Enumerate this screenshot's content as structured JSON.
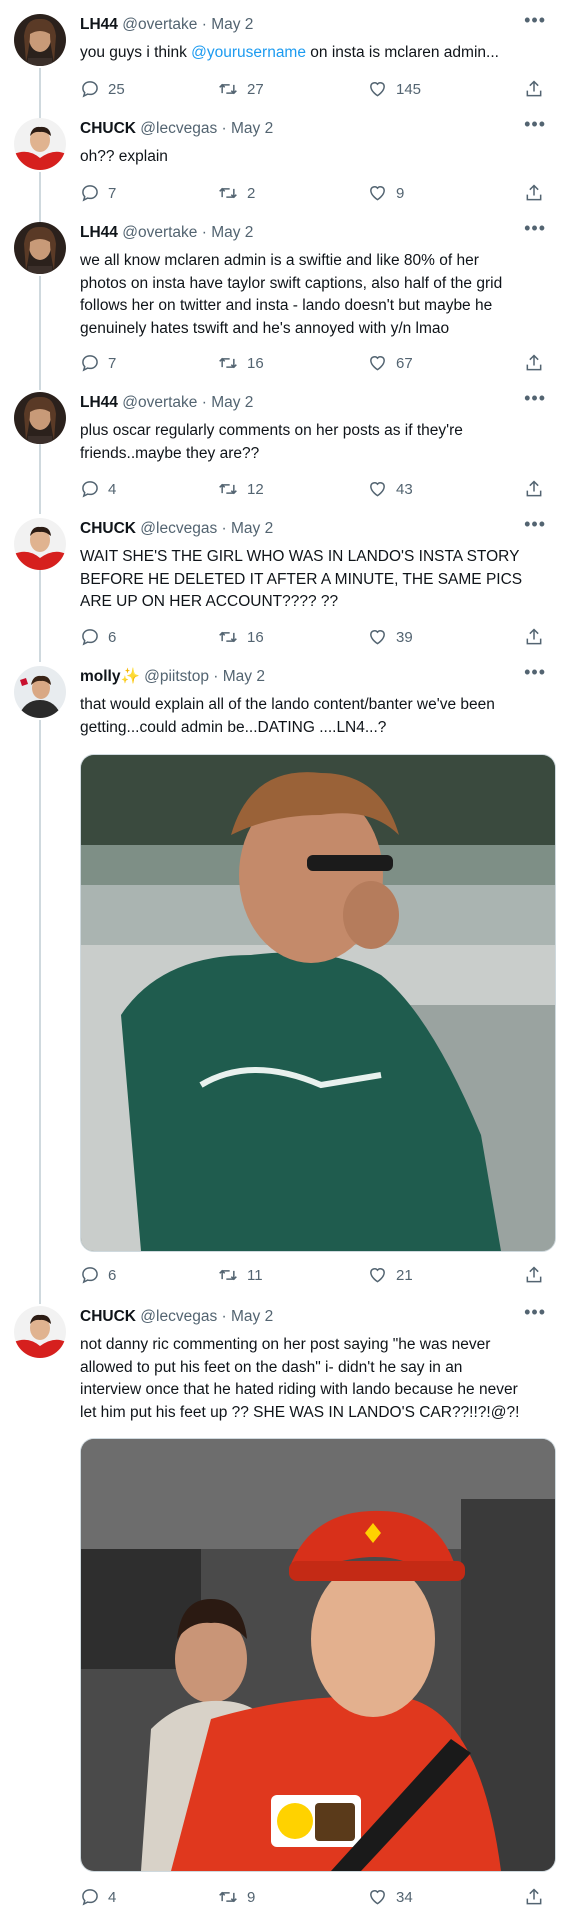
{
  "tweets": [
    {
      "name": "LH44",
      "handle": "@overtake",
      "sep": "·",
      "date": "May 2",
      "text_pre": "you guys i think ",
      "mention": "@yourusername",
      "text_post": " on insta is mclaren admin...",
      "replies": "25",
      "retweets": "27",
      "likes": "145"
    },
    {
      "name": "CHUCK",
      "handle": "@lecvegas",
      "sep": "·",
      "date": "May 2",
      "text": "oh?? explain",
      "replies": "7",
      "retweets": "2",
      "likes": "9"
    },
    {
      "name": "LH44",
      "handle": "@overtake",
      "sep": "·",
      "date": "May 2",
      "lines": [
        "we all know mclaren admin is a swiftie and like 80% of her",
        "photos on insta have taylor swift captions, also half of the grid",
        "follows her on twitter and insta - lando doesn't but maybe he",
        "genuinely hates tswift and he's annoyed with y/n lmao"
      ],
      "replies": "7",
      "retweets": "16",
      "likes": "67"
    },
    {
      "name": "LH44",
      "handle": "@overtake",
      "sep": "·",
      "date": "May 2",
      "lines": [
        "plus oscar regularly comments on her posts as if they're",
        "friends..maybe they are??"
      ],
      "replies": "4",
      "retweets": "12",
      "likes": "43"
    },
    {
      "name": "CHUCK",
      "handle": "@lecvegas",
      "sep": "·",
      "date": "May 2",
      "lines": [
        "WAIT SHE'S THE GIRL WHO WAS IN LANDO'S INSTA STORY",
        "BEFORE HE DELETED IT AFTER A MINUTE, THE SAME PICS",
        "ARE UP ON HER ACCOUNT???? ??"
      ],
      "replies": "6",
      "retweets": "16",
      "likes": "39"
    },
    {
      "name": "molly",
      "sparkle": "✨",
      "handle": "@piitstop",
      "sep": "·",
      "date": "May 2",
      "lines": [
        "that would explain all of the lando content/banter we've been",
        "getting...could admin be...DATING ....LN4...?"
      ],
      "replies": "6",
      "retweets": "11",
      "likes": "21"
    },
    {
      "name": "CHUCK",
      "handle": "@lecvegas",
      "sep": "·",
      "date": "May 2",
      "lines": [
        "not danny ric commenting on her post saying \"he was never",
        "allowed to put his feet on the dash\" i- didn't he say in an",
        "interview once that he hated riding with lando because he never",
        "let him put his feet up ?? SHE WAS IN LANDO'S CAR??!!?!@?!"
      ],
      "replies": "4",
      "retweets": "9",
      "likes": "34"
    }
  ],
  "colors": {
    "link": "#1d9bf0",
    "muted": "#536471",
    "thread": "#cfd9de"
  },
  "icons": {
    "more": "more-icon",
    "reply": "reply-icon",
    "retweet": "retweet-icon",
    "like": "like-icon",
    "share": "share-icon"
  }
}
